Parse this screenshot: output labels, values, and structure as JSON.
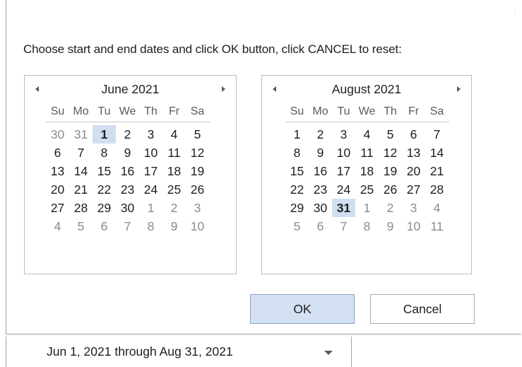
{
  "instructions": "Choose start and end dates and click OK button, click CANCEL to reset:",
  "weekdays": [
    "Su",
    "Mo",
    "Tu",
    "We",
    "Th",
    "Fr",
    "Sa"
  ],
  "calendars": [
    {
      "title": "June 2021",
      "weeks": [
        [
          {
            "d": "30",
            "o": true
          },
          {
            "d": "31",
            "o": true
          },
          {
            "d": "1",
            "s": true
          },
          {
            "d": "2"
          },
          {
            "d": "3"
          },
          {
            "d": "4"
          },
          {
            "d": "5"
          }
        ],
        [
          {
            "d": "6"
          },
          {
            "d": "7"
          },
          {
            "d": "8"
          },
          {
            "d": "9"
          },
          {
            "d": "10"
          },
          {
            "d": "11"
          },
          {
            "d": "12"
          }
        ],
        [
          {
            "d": "13"
          },
          {
            "d": "14"
          },
          {
            "d": "15"
          },
          {
            "d": "16"
          },
          {
            "d": "17"
          },
          {
            "d": "18"
          },
          {
            "d": "19"
          }
        ],
        [
          {
            "d": "20"
          },
          {
            "d": "21"
          },
          {
            "d": "22"
          },
          {
            "d": "23"
          },
          {
            "d": "24"
          },
          {
            "d": "25"
          },
          {
            "d": "26"
          }
        ],
        [
          {
            "d": "27"
          },
          {
            "d": "28"
          },
          {
            "d": "29"
          },
          {
            "d": "30"
          },
          {
            "d": "1",
            "o": true
          },
          {
            "d": "2",
            "o": true
          },
          {
            "d": "3",
            "o": true
          }
        ],
        [
          {
            "d": "4",
            "o": true
          },
          {
            "d": "5",
            "o": true
          },
          {
            "d": "6",
            "o": true
          },
          {
            "d": "7",
            "o": true
          },
          {
            "d": "8",
            "o": true
          },
          {
            "d": "9",
            "o": true
          },
          {
            "d": "10",
            "o": true
          }
        ]
      ]
    },
    {
      "title": "August 2021",
      "weeks": [
        [
          {
            "d": "1"
          },
          {
            "d": "2"
          },
          {
            "d": "3"
          },
          {
            "d": "4"
          },
          {
            "d": "5"
          },
          {
            "d": "6"
          },
          {
            "d": "7"
          }
        ],
        [
          {
            "d": "8"
          },
          {
            "d": "9"
          },
          {
            "d": "10"
          },
          {
            "d": "11"
          },
          {
            "d": "12"
          },
          {
            "d": "13"
          },
          {
            "d": "14"
          }
        ],
        [
          {
            "d": "15"
          },
          {
            "d": "16"
          },
          {
            "d": "17"
          },
          {
            "d": "18"
          },
          {
            "d": "19"
          },
          {
            "d": "20"
          },
          {
            "d": "21"
          }
        ],
        [
          {
            "d": "22"
          },
          {
            "d": "23"
          },
          {
            "d": "24"
          },
          {
            "d": "25"
          },
          {
            "d": "26"
          },
          {
            "d": "27"
          },
          {
            "d": "28"
          }
        ],
        [
          {
            "d": "29"
          },
          {
            "d": "30"
          },
          {
            "d": "31",
            "s": true
          },
          {
            "d": "1",
            "o": true
          },
          {
            "d": "2",
            "o": true
          },
          {
            "d": "3",
            "o": true
          },
          {
            "d": "4",
            "o": true
          }
        ],
        [
          {
            "d": "5",
            "o": true
          },
          {
            "d": "6",
            "o": true
          },
          {
            "d": "7",
            "o": true
          },
          {
            "d": "8",
            "o": true
          },
          {
            "d": "9",
            "o": true
          },
          {
            "d": "10",
            "o": true
          },
          {
            "d": "11",
            "o": true
          }
        ]
      ]
    }
  ],
  "buttons": {
    "ok": "OK",
    "cancel": "Cancel"
  },
  "combo": {
    "value": "Jun 1, 2021 through Aug 31, 2021"
  },
  "colors": {
    "selected_bg": "#cfdff0",
    "ok_bg": "#d2e0f1",
    "other_month_text": "#8c8c8c"
  },
  "icons": {
    "prev": "triangle-left-icon",
    "next": "triangle-right-icon",
    "dropdown": "chevron-down-icon",
    "resize": "resize-grip-icon"
  }
}
